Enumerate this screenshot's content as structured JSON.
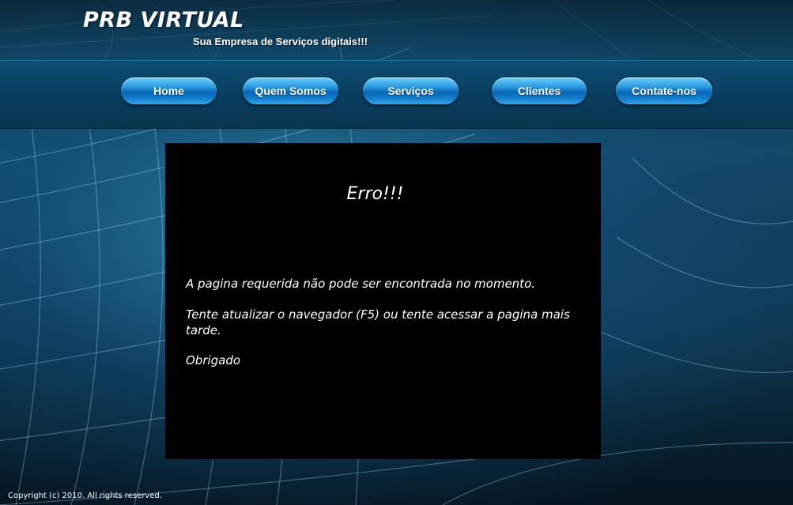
{
  "header": {
    "title": "PRB VIRTUAL",
    "tagline": "Sua Empresa de Serviços digitais!!!"
  },
  "nav": {
    "items": [
      {
        "label": "Home"
      },
      {
        "label": "Quem Somos"
      },
      {
        "label": "Serviços"
      },
      {
        "label": "Clientes"
      },
      {
        "label": "Contate-nos"
      }
    ]
  },
  "main": {
    "heading": "Erro!!!",
    "line1": "A pagina requerida não pode ser encontrada no momento.",
    "line2": "Tente atualizar o navegador (F5) ou tente acessar a pagina mais tarde.",
    "line3": "Obrigado"
  },
  "footer": {
    "copyright": "Copyright (c) 2010. All rights reserved."
  },
  "colors": {
    "nav_button": "#1a8ad6",
    "content_bg": "#000000",
    "background": "#134b6a"
  }
}
